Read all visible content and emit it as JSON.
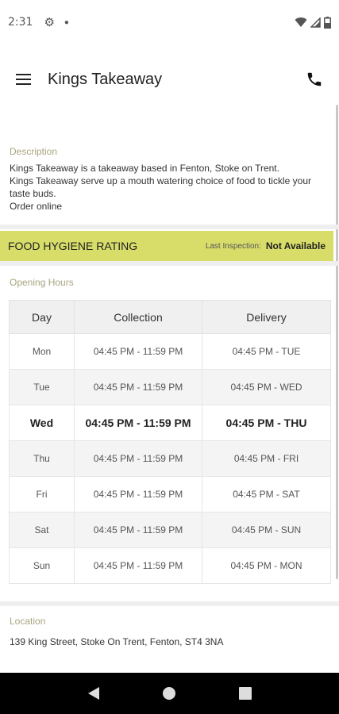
{
  "status_bar": {
    "time": "2:31",
    "icons": [
      "gear-icon",
      "dot-icon",
      "wifi-icon",
      "signal-icon",
      "battery-icon"
    ]
  },
  "app_bar": {
    "title": "Kings Takeaway",
    "icons": [
      "menu-icon",
      "phone-icon"
    ]
  },
  "description": {
    "label": "Description",
    "text": "Kings Takeaway is a takeaway based in Fenton, Stoke on Trent.\nKings Takeaway serve up a mouth watering choice of food to tickle your taste buds.\nOrder online"
  },
  "hygiene": {
    "title": "FOOD HYGIENE RATING",
    "last_inspection_label": "Last Inspection:",
    "last_inspection_value": "Not Available",
    "color": "#d8dd6a"
  },
  "opening_hours": {
    "label": "Opening Hours",
    "headers": [
      "Day",
      "Collection",
      "Delivery"
    ],
    "rows": [
      {
        "day": "Mon",
        "collection": "04:45 PM - 11:59 PM",
        "delivery": "04:45 PM - TUE"
      },
      {
        "day": "Tue",
        "collection": "04:45 PM - 11:59 PM",
        "delivery": "04:45 PM - WED"
      },
      {
        "day": "Wed",
        "collection": "04:45 PM - 11:59 PM",
        "delivery": "04:45 PM - THU"
      },
      {
        "day": "Thu",
        "collection": "04:45 PM - 11:59 PM",
        "delivery": "04:45 PM - FRI"
      },
      {
        "day": "Fri",
        "collection": "04:45 PM - 11:59 PM",
        "delivery": "04:45 PM - SAT"
      },
      {
        "day": "Sat",
        "collection": "04:45 PM - 11:59 PM",
        "delivery": "04:45 PM - SUN"
      },
      {
        "day": "Sun",
        "collection": "04:45 PM - 11:59 PM",
        "delivery": "04:45 PM - MON"
      }
    ],
    "highlighted_day": "Wed"
  },
  "location": {
    "label": "Location",
    "address": "139 King Street, Stoke On Trent, Fenton, ST4 3NA"
  },
  "nav_bar": {
    "icons": [
      "back-icon",
      "home-icon",
      "recents-icon"
    ]
  }
}
